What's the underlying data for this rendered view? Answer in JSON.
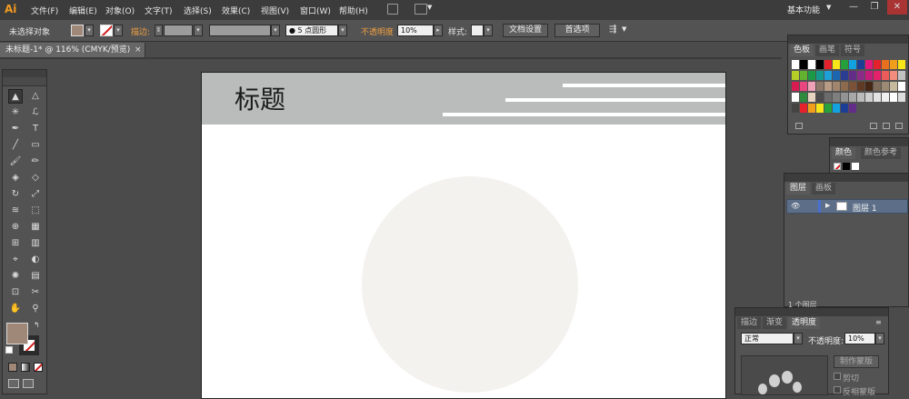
{
  "app": {
    "logo": "Ai",
    "workspace": "基本功能"
  },
  "menu": [
    "文件(F)",
    "编辑(E)",
    "对象(O)",
    "文字(T)",
    "选择(S)",
    "效果(C)",
    "视图(V)",
    "窗口(W)",
    "帮助(H)"
  ],
  "window_controls": {
    "minimize": "—",
    "restore": "❐",
    "close": "✕"
  },
  "control_bar": {
    "selection_label": "未选择对象",
    "stroke_label": "描边:",
    "brush_value": "5 点圆形",
    "opacity_label": "不透明度",
    "opacity_value": "10%",
    "style_label": "样式:",
    "doc_setup_button": "文档设置",
    "prefs_button": "首选项",
    "fill_color": "#a08878",
    "stroke_none_color": "#d21d1d"
  },
  "document": {
    "tab_title": "未标题-1* @ 116% (CMYK/预览)",
    "close": "×"
  },
  "artboard": {
    "title": "标题",
    "header_color": "#b9bcbb",
    "circle_color": "#f4f2ef"
  },
  "swatches_panel": {
    "tabs": [
      "色板",
      "画笔",
      "符号"
    ],
    "rows": [
      [
        "#ffffff",
        "#000000",
        "#ffffff",
        "#000000",
        "#e5222c",
        "#f7e51a",
        "#25a03a",
        "#13a2e0",
        "#1c3f95",
        "#e4187b",
        "#e5222c",
        "#e76f1d",
        "#f19e1c",
        "#f7e51a"
      ],
      [
        "#b6cf26",
        "#63b22f",
        "#1b9a45",
        "#139a8f",
        "#1d9fd9",
        "#1d67b2",
        "#2b3d93",
        "#622d89",
        "#8a2c88",
        "#c51b7d",
        "#e6216c",
        "#eb5b5a",
        "#f28c7d",
        "#c2c2c2"
      ],
      [
        "#d81c52",
        "#e9457f",
        "#f0a1b8",
        "#8d7768",
        "#b79b84",
        "#a1866d",
        "#8c6a4d",
        "#7b5238",
        "#5f3a24",
        "#462615",
        "#7e6b59",
        "#9c8a74",
        "#c7b99e",
        "#ffffff"
      ],
      [
        "#ffffff",
        "#2e8b3d",
        "#e6d3c0",
        "#4b4b4b",
        "#6b6b6b",
        "#7f7f7f",
        "#939393",
        "#a7a7a7",
        "#bbbbbb",
        "#cfcfcf",
        "#e3e3e3",
        "#f0f0f0",
        "#ffffff",
        "#dddddd"
      ],
      [
        "#444444",
        "#e5222c",
        "#f19e1c",
        "#f7e51a",
        "#25a03a",
        "#13a2e0",
        "#1c3f95",
        "#622d89"
      ]
    ]
  },
  "color_panel": {
    "tabs": [
      "颜色",
      "颜色参考"
    ]
  },
  "layers_panel": {
    "tabs": [
      "图层",
      "画板"
    ],
    "layer_name": "图层 1",
    "footer": "1 个图层",
    "layer_color": "#4a6fd0"
  },
  "transparency_panel": {
    "tabs": [
      "描边",
      "渐变",
      "透明度"
    ],
    "blend_mode": "正常",
    "opacity_label": "不透明度:",
    "opacity_value": "10%",
    "make_mask_button": "制作蒙版",
    "clip_label": "剪切",
    "invert_label": "反相蒙版"
  },
  "icons": {
    "selection": "▲",
    "direct_selection": "△",
    "magic_wand": "✳",
    "lasso": "ℒ",
    "pen": "✒",
    "type": "T",
    "line": "╱",
    "rect": "▭",
    "paintbrush": "🖌",
    "pencil": "✏",
    "blob_brush": "◈",
    "eraser": "◇",
    "rotate": "↻",
    "scale": "⤢",
    "warp": "≋",
    "free_transform": "⬚",
    "shape_builder": "⊕",
    "perspective": "▦",
    "mesh": "⊞",
    "gradient": "▥",
    "eyedropper": "⌖",
    "blend": "◐",
    "symbol_sprayer": "✺",
    "graph": "▤",
    "artboard": "⊡",
    "slice": "✂",
    "hand": "✋",
    "zoom": "⚲"
  }
}
